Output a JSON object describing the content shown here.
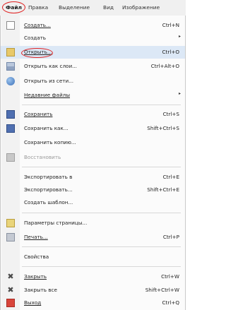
{
  "menubar": {
    "items": [
      {
        "label": "Файл"
      },
      {
        "label": "Правка"
      },
      {
        "label": "Выделение"
      },
      {
        "label": "Вид"
      },
      {
        "label": "Изображение"
      }
    ]
  },
  "menu": {
    "items": [
      {
        "label": "Создать...",
        "shortcut": "Ctrl+N",
        "icon": "new-icon"
      },
      {
        "label": "Создать",
        "submenu": "▸"
      },
      {
        "label": "Открыть...",
        "shortcut": "Ctrl+O",
        "icon": "open-icon"
      },
      {
        "label": "Открыть как слои...",
        "shortcut": "Ctrl+Alt+O",
        "icon": "layers-icon"
      },
      {
        "label": "Открыть из сети...",
        "icon": "globe-icon"
      },
      {
        "label": "Недавние файлы",
        "submenu": "▸"
      },
      {
        "label": "Сохранить",
        "shortcut": "Ctrl+S",
        "icon": "save-icon"
      },
      {
        "label": "Сохранить как...",
        "shortcut": "Shift+Ctrl+S",
        "icon": "save-as-icon"
      },
      {
        "label": "Сохранить копию..."
      },
      {
        "label": "Восстановить",
        "icon": "revert-icon"
      },
      {
        "label": "Экспортировать в",
        "shortcut": "Ctrl+E"
      },
      {
        "label": "Экспортировать...",
        "shortcut": "Shift+Ctrl+E"
      },
      {
        "label": "Создать шаблон..."
      },
      {
        "label": "Параметры страницы...",
        "icon": "page-setup-icon"
      },
      {
        "label": "Печать...",
        "shortcut": "Ctrl+P",
        "icon": "print-icon"
      },
      {
        "label": "Свойства"
      },
      {
        "label": "Закрыть",
        "shortcut": "Ctrl+W",
        "icon": "close-icon",
        "glyph": "✖"
      },
      {
        "label": "Закрыть все",
        "shortcut": "Shift+Ctrl+W",
        "icon": "close-all-icon",
        "glyph": "✖"
      },
      {
        "label": "Выход",
        "shortcut": "Ctrl+Q",
        "icon": "quit-icon"
      }
    ]
  },
  "colors": {
    "annotation_ring": "#e02020",
    "highlight": "#dce8f6"
  }
}
